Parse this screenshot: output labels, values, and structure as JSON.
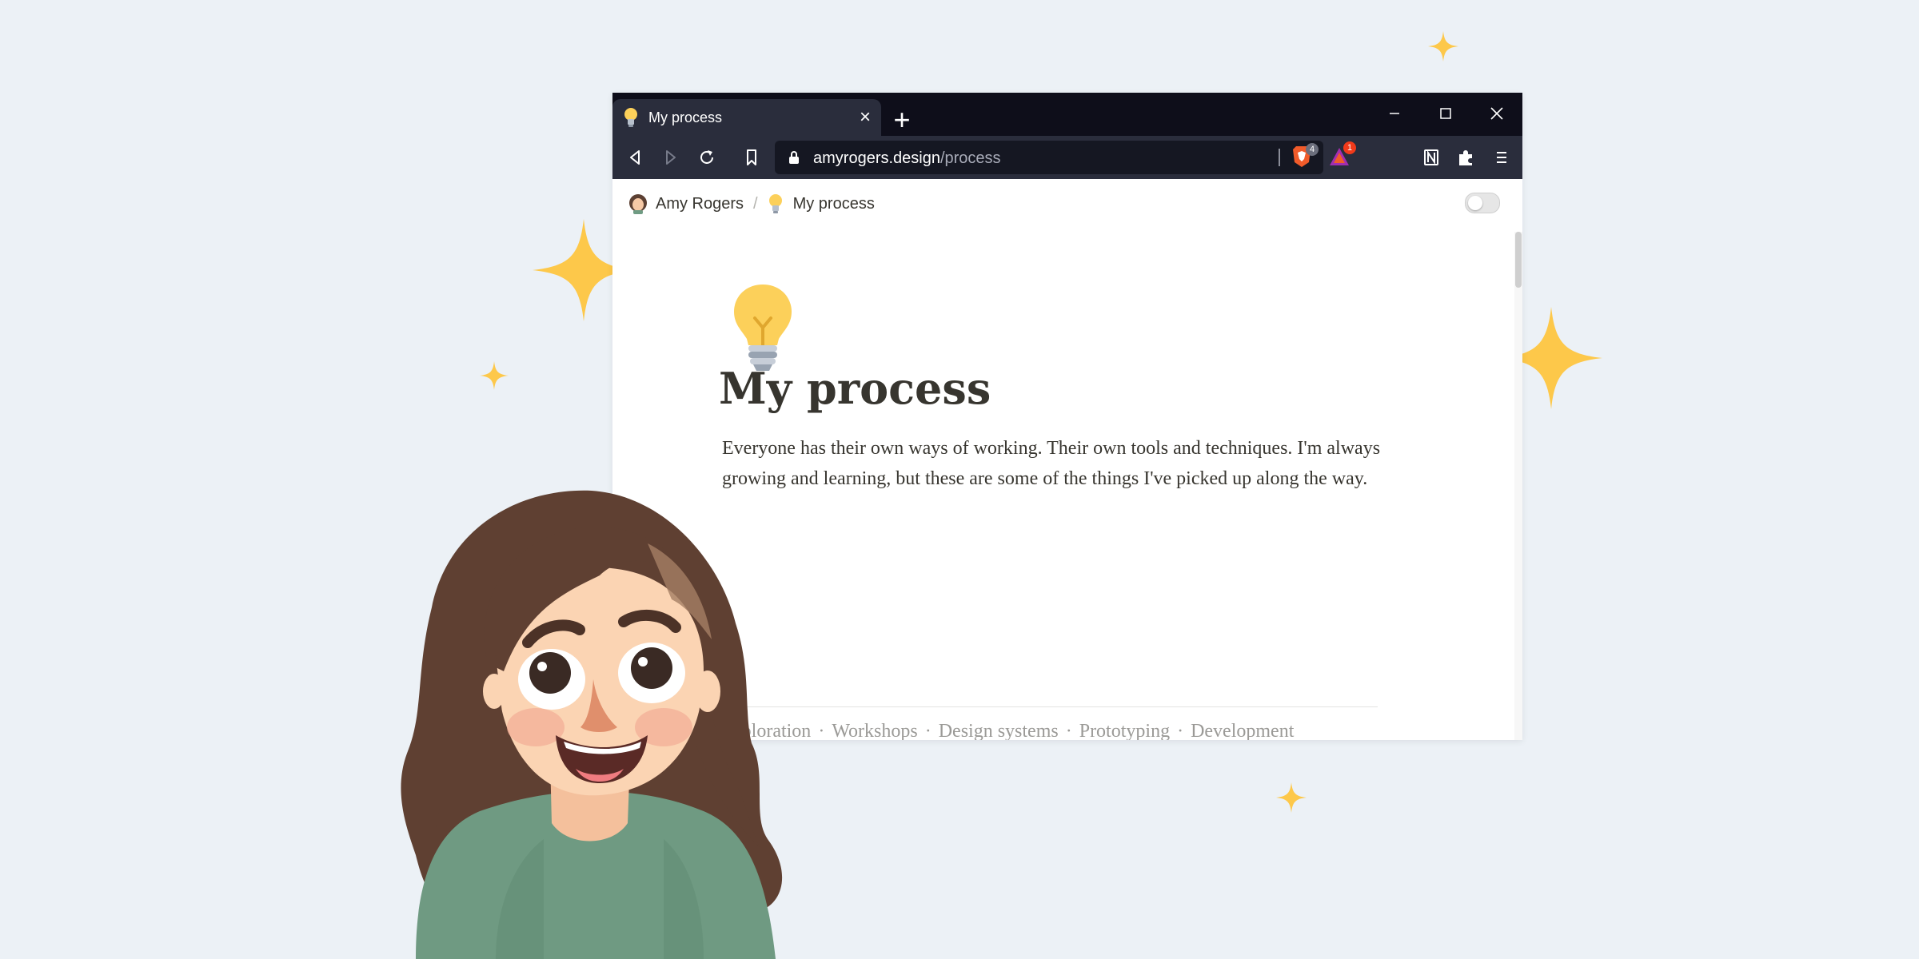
{
  "browser": {
    "tab": {
      "title": "My process",
      "favicon": "lightbulb-icon"
    },
    "window_controls": [
      "minimize-icon",
      "maximize-icon",
      "close-icon"
    ],
    "url": {
      "host": "amyrogers.design",
      "path": "/process"
    },
    "shield_count": "4",
    "rewards_count": "1"
  },
  "breadcrumb": [
    {
      "label": "Amy Rogers",
      "icon": "avatar-icon"
    },
    {
      "label": "My process",
      "icon": "lightbulb-icon"
    }
  ],
  "breadcrumb_separator": "/",
  "page": {
    "icon": "lightbulb-icon",
    "title": "My process",
    "intro": "Everyone has their own ways of working. Their own tools and techniques. I'm always growing and learning, but these are some of the things I've picked up along the way.",
    "section_links": [
      "Exploration",
      "Workshops",
      "Design systems",
      "Prototyping",
      "Development"
    ],
    "link_separator": "·"
  },
  "colors": {
    "background": "#ecf1f6",
    "sparkle": "#fdc84a",
    "titlebar": "#0e0e1a",
    "toolbar": "#2a2d3c",
    "text": "#37352f"
  }
}
